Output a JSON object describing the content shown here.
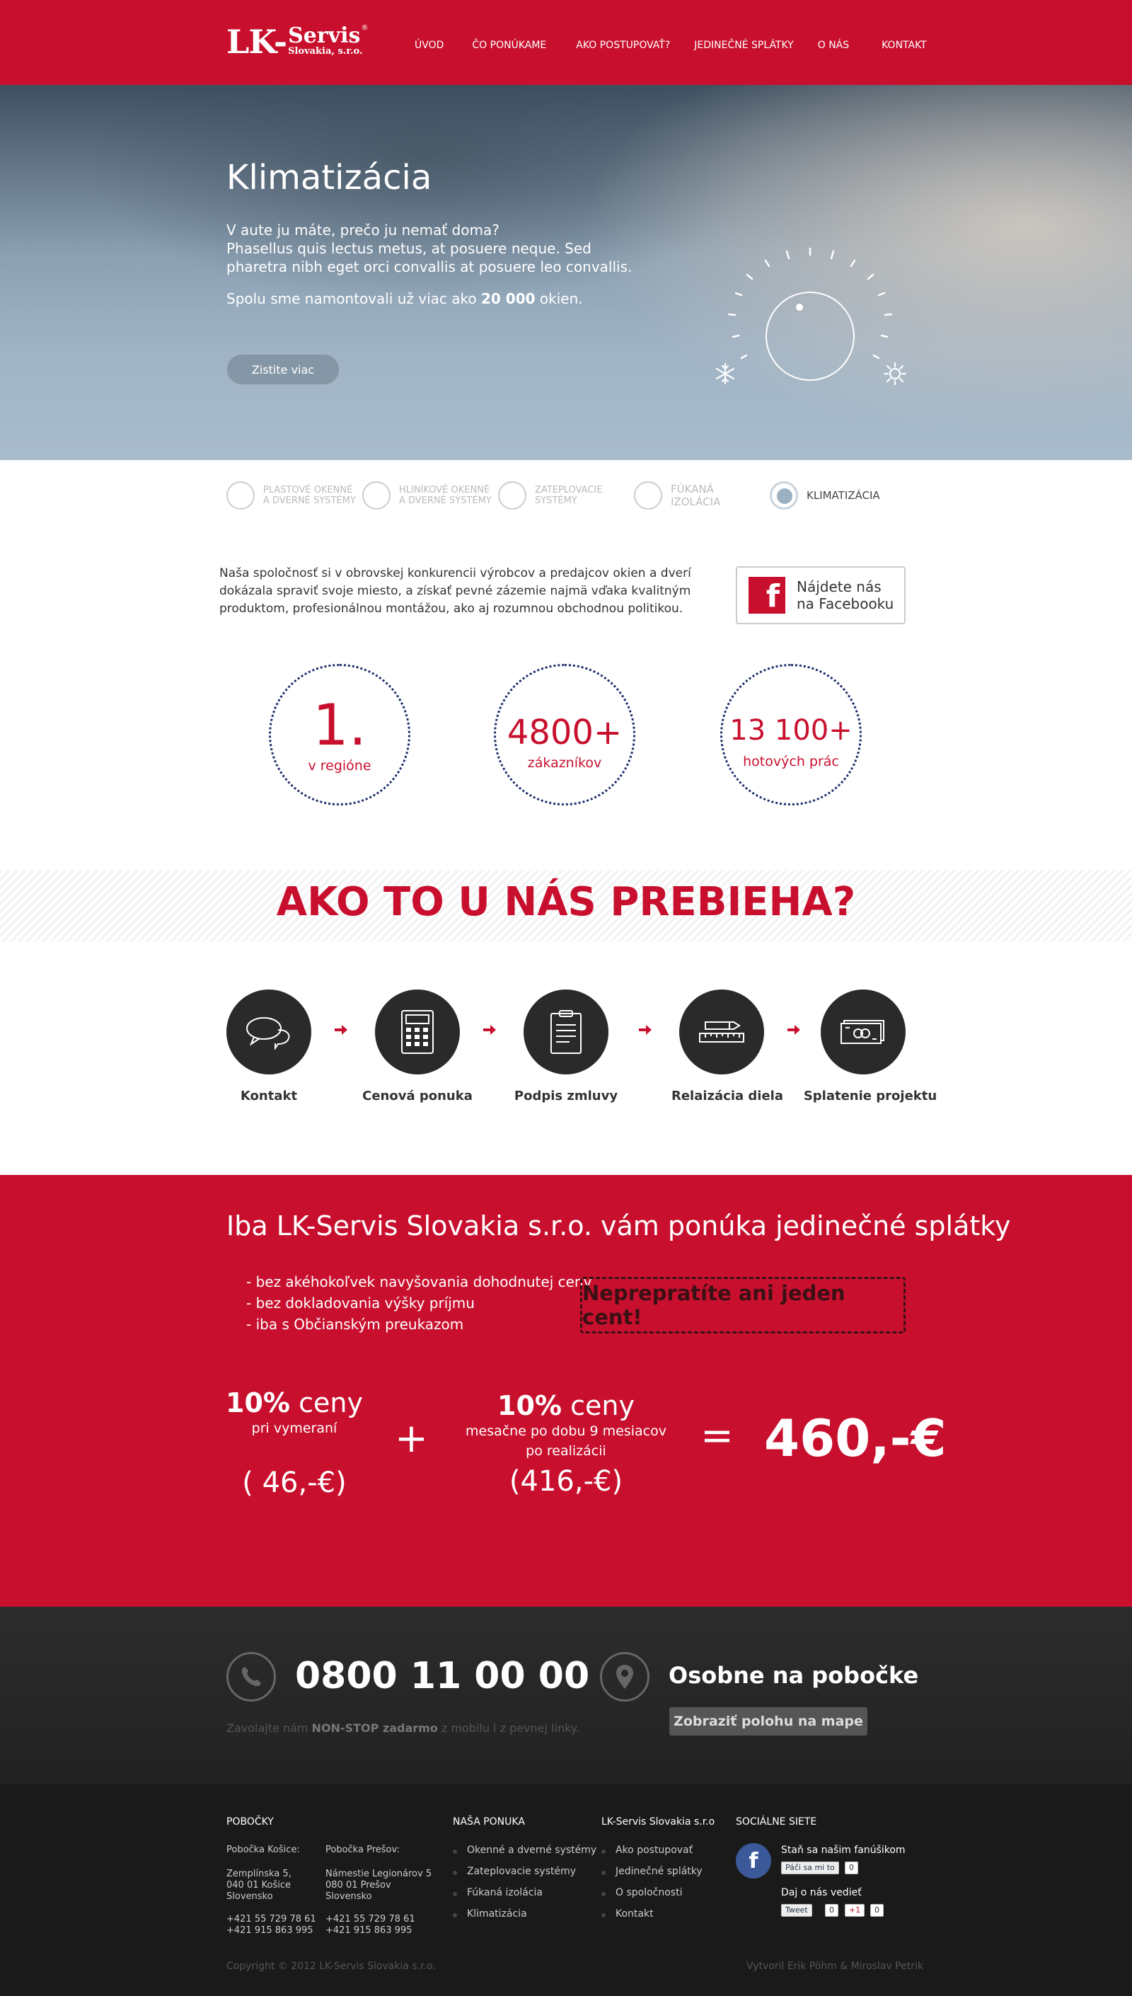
{
  "header": {
    "logo_lk": "LK-",
    "logo_servis": "Servis",
    "logo_sub": "Slovakia, s.r.o.",
    "logo_reg": "®",
    "nav": [
      "ÚVOD",
      "ČO PONÚKAME",
      "AKO POSTUPOVAŤ?",
      "JEDINEČNÉ SPLÁTKY",
      "O NÁS",
      "KONTAKT"
    ]
  },
  "hero": {
    "title": "Klimatizácia",
    "text_line1": "V aute ju máte, prečo ju nemať doma?",
    "text_line2": "Phasellus quis lectus metus, at posuere neque. Sed pharetra nibh eget orci convallis at posuere leo convallis.",
    "count_prefix": "Spolu sme namontovali už viac ako",
    "count_value": "20 000",
    "count_suffix": "okien.",
    "button": "Zistite viac"
  },
  "tabs": [
    {
      "line1": "PLASTOVÉ OKENNÉ",
      "line2": "A DVERNÉ SYSTÉMY",
      "active": false
    },
    {
      "line1": "HLINÍKOVÉ OKENNÉ",
      "line2": "A DVERNÉ SYSTÉMY",
      "active": false
    },
    {
      "line1": "ZATEPLOVACIE",
      "line2": "SYSTÉMY",
      "active": false
    },
    {
      "line1": "FÚKANÁ",
      "line2": "IZOLÁCIA",
      "active": false
    },
    {
      "line1": "KLIMATIZÁCIA",
      "line2": "",
      "active": true
    }
  ],
  "intro": {
    "text": "Naša spoločnosť si v obrovskej konkurencii výrobcov a predajcov okien a dverí dokázala spraviť svoje miesto, a získať pevné zázemie najmä vďaka kvalitným produktom, profesionálnou montážou, ako aj rozumnou obchodnou politikou.",
    "fb_icon": "f",
    "fb_line1": "Nájdete nás",
    "fb_line2": "na Facebooku"
  },
  "stats": [
    {
      "value": "1.",
      "label": "v regióne"
    },
    {
      "value": "4800+",
      "label": "zákazníkov"
    },
    {
      "value": "13 100+",
      "label": "hotových prác"
    }
  ],
  "process": {
    "title": "AKO TO U NÁS PREBIEHA?",
    "steps": [
      {
        "label": "Kontakt",
        "icon": "chat-bubbles-icon"
      },
      {
        "label": "Cenová ponuka",
        "icon": "calculator-icon"
      },
      {
        "label": "Podpis zmluvy",
        "icon": "clipboard-icon"
      },
      {
        "label": "Relaizácia diela",
        "icon": "ruler-pencil-icon"
      },
      {
        "label": "Splatenie projektu",
        "icon": "banknote-icon"
      }
    ]
  },
  "installments": {
    "title": "Iba LK-Servis Slovakia s.r.o. vám ponúka jedinečné splátky",
    "bullets": [
      "- bez akéhokoľvek navyšovania dohodnutej ceny",
      "- bez dokladovania výšky príjmu",
      "- iba s Občianským preukazom"
    ],
    "highlight": "Neprepratíte ani jeden cent!",
    "first_pct": "10%",
    "first_word": "ceny",
    "first_sub": "pri vymeraní",
    "first_amount": "( 46,-€)",
    "plus": "+",
    "second_pct": "10%",
    "second_word": "ceny",
    "second_sub1": "mesačne po dobu 9 mesiacov",
    "second_sub2": "po realizácii",
    "second_amount": "(416,-€)",
    "equals": "=",
    "total": "460,-€"
  },
  "contact": {
    "phone": "0800 11 00 00",
    "note_prefix": "Zavolajte nám",
    "note_bold": "NON-STOP zadarmo",
    "note_suffix": "z mobilu i z pevnej linky.",
    "branch_title": "Osobne na pobočke",
    "map_button": "Zobraziť polohu na mape"
  },
  "footer": {
    "branches_title": "POBOČKY",
    "kosice_title": "Pobočka Košice:",
    "kosice_addr1": "Zemplínska 5,",
    "kosice_addr2": "040 01 Košice",
    "kosice_addr3": "Slovensko",
    "kosice_tel1": "+421 55 729 78 61",
    "kosice_tel2": "+421 915 863 995",
    "presov_title": "Pobočka Prešov:",
    "presov_addr1": "Námestie Legionárov 5",
    "presov_addr2": "080 01 Prešov",
    "presov_addr3": "Slovensko",
    "presov_tel1": "+421 55 729 78 61",
    "presov_tel2": "+421 915 863 995",
    "offer_title": "NAŠA PONUKA",
    "offer_items": [
      "Okenné a dverné systémy",
      "Zateplovacie systémy",
      "Fúkaná izolácia",
      "Klimatizácia"
    ],
    "company_title": "LK-Servis Slovakia s.r.o",
    "company_items": [
      "Ako postupovať",
      "Jedinečné splátky",
      "O spoločnosti",
      "Kontakt"
    ],
    "social_title": "SOCIÁLNE SIETE",
    "fan_text": "Staň sa našim fanúšikom",
    "like_label": "Páči sa mi to",
    "like_count": "0",
    "share_text": "Daj o nás vedieť",
    "tweet_label": "Tweet",
    "tweet_count": "0",
    "gplus_label": "+1",
    "gplus_count": "0",
    "fb_icon": "f",
    "copyright": "Copyright © 2012 LK-Servis Slovakia s.r.o.",
    "credits": "Vytvoril Erik Pöhm & Miroslav Petrik"
  },
  "colors": {
    "brand_red": "#c8102e",
    "dark": "#1a1a1a",
    "circle_blue": "#1e2e6e"
  }
}
